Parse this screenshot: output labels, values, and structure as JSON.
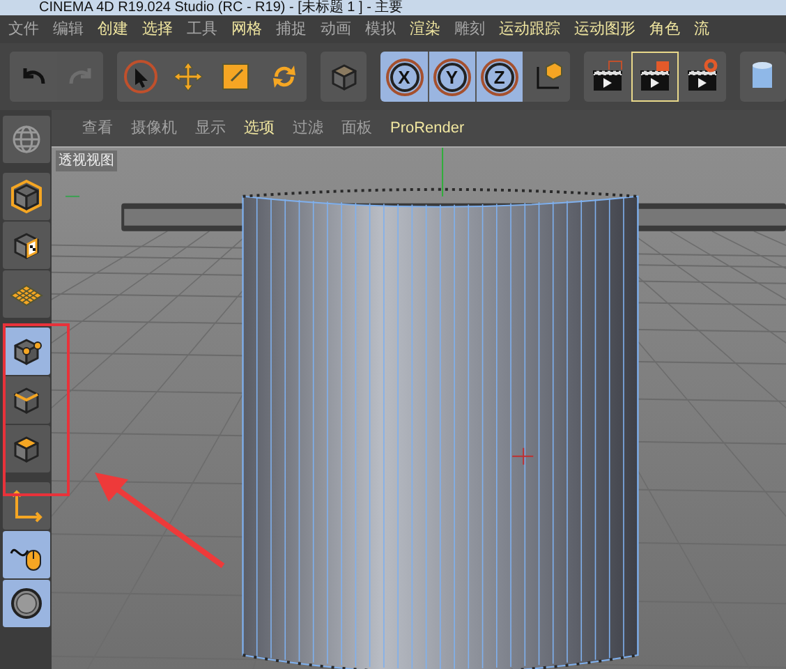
{
  "window": {
    "title": "CINEMA 4D R19.024 Studio (RC - R19) - [未标题 1 ] - 主要"
  },
  "menu": [
    {
      "label": "文件",
      "accent": false
    },
    {
      "label": "编辑",
      "accent": false
    },
    {
      "label": "创建",
      "accent": true
    },
    {
      "label": "选择",
      "accent": true
    },
    {
      "label": "工具",
      "accent": false
    },
    {
      "label": "网格",
      "accent": true
    },
    {
      "label": "捕捉",
      "accent": false
    },
    {
      "label": "动画",
      "accent": false
    },
    {
      "label": "模拟",
      "accent": false
    },
    {
      "label": "渲染",
      "accent": true
    },
    {
      "label": "雕刻",
      "accent": false
    },
    {
      "label": "运动跟踪",
      "accent": true
    },
    {
      "label": "运动图形",
      "accent": true
    },
    {
      "label": "角色",
      "accent": true
    },
    {
      "label": "流",
      "accent": true
    }
  ],
  "toolbar": [
    [
      {
        "kind": "undo",
        "selected": false,
        "disabled": false
      },
      {
        "kind": "redo",
        "selected": false,
        "disabled": true
      }
    ],
    [
      {
        "kind": "select",
        "selected": false,
        "disabled": false
      },
      {
        "kind": "move",
        "selected": false,
        "disabled": false
      },
      {
        "kind": "scale",
        "selected": false,
        "disabled": false
      },
      {
        "kind": "rotate",
        "selected": false,
        "disabled": false
      }
    ],
    [
      {
        "kind": "cube",
        "selected": false,
        "disabled": false
      }
    ],
    [
      {
        "kind": "x",
        "label": "X",
        "selected": true,
        "disabled": false
      },
      {
        "kind": "y",
        "label": "Y",
        "selected": true,
        "disabled": false
      },
      {
        "kind": "z",
        "label": "Z",
        "selected": true,
        "disabled": false
      },
      {
        "kind": "coords",
        "selected": false,
        "disabled": false
      }
    ],
    [
      {
        "kind": "render-view",
        "selected": false,
        "disabled": false
      },
      {
        "kind": "render-picture",
        "selected": true,
        "disabled": false
      },
      {
        "kind": "render-settings",
        "selected": false,
        "disabled": false
      }
    ],
    [
      {
        "kind": "cylinder",
        "selected": false,
        "disabled": false
      }
    ]
  ],
  "viewport": {
    "menu": [
      {
        "label": "查看",
        "accent": false
      },
      {
        "label": "摄像机",
        "accent": false
      },
      {
        "label": "显示",
        "accent": false
      },
      {
        "label": "选项",
        "accent": true
      },
      {
        "label": "过滤",
        "accent": false
      },
      {
        "label": "面板",
        "accent": false
      },
      {
        "label": "ProRender",
        "accent": true
      }
    ],
    "label": "透视视图"
  },
  "sidebar": [
    {
      "kind": "globe",
      "selected": false
    },
    {
      "kind": "model",
      "selected": false
    },
    {
      "kind": "texture",
      "selected": false
    },
    {
      "kind": "workplane",
      "selected": false
    },
    {
      "kind": "points",
      "selected": true
    },
    {
      "kind": "edges",
      "selected": false
    },
    {
      "kind": "polygons",
      "selected": false
    },
    {
      "kind": "axis",
      "selected": false
    },
    {
      "kind": "tweak",
      "selected": true
    },
    {
      "kind": "snap",
      "selected": true
    }
  ]
}
